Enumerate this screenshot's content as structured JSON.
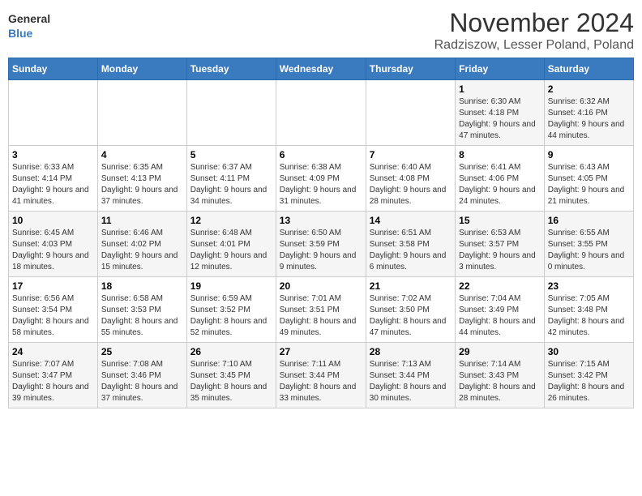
{
  "logo": {
    "text_general": "General",
    "text_blue": "Blue"
  },
  "title": "November 2024",
  "location": "Radziszow, Lesser Poland, Poland",
  "days_of_week": [
    "Sunday",
    "Monday",
    "Tuesday",
    "Wednesday",
    "Thursday",
    "Friday",
    "Saturday"
  ],
  "weeks": [
    [
      {
        "day": "",
        "info": ""
      },
      {
        "day": "",
        "info": ""
      },
      {
        "day": "",
        "info": ""
      },
      {
        "day": "",
        "info": ""
      },
      {
        "day": "",
        "info": ""
      },
      {
        "day": "1",
        "info": "Sunrise: 6:30 AM\nSunset: 4:18 PM\nDaylight: 9 hours and 47 minutes."
      },
      {
        "day": "2",
        "info": "Sunrise: 6:32 AM\nSunset: 4:16 PM\nDaylight: 9 hours and 44 minutes."
      }
    ],
    [
      {
        "day": "3",
        "info": "Sunrise: 6:33 AM\nSunset: 4:14 PM\nDaylight: 9 hours and 41 minutes."
      },
      {
        "day": "4",
        "info": "Sunrise: 6:35 AM\nSunset: 4:13 PM\nDaylight: 9 hours and 37 minutes."
      },
      {
        "day": "5",
        "info": "Sunrise: 6:37 AM\nSunset: 4:11 PM\nDaylight: 9 hours and 34 minutes."
      },
      {
        "day": "6",
        "info": "Sunrise: 6:38 AM\nSunset: 4:09 PM\nDaylight: 9 hours and 31 minutes."
      },
      {
        "day": "7",
        "info": "Sunrise: 6:40 AM\nSunset: 4:08 PM\nDaylight: 9 hours and 28 minutes."
      },
      {
        "day": "8",
        "info": "Sunrise: 6:41 AM\nSunset: 4:06 PM\nDaylight: 9 hours and 24 minutes."
      },
      {
        "day": "9",
        "info": "Sunrise: 6:43 AM\nSunset: 4:05 PM\nDaylight: 9 hours and 21 minutes."
      }
    ],
    [
      {
        "day": "10",
        "info": "Sunrise: 6:45 AM\nSunset: 4:03 PM\nDaylight: 9 hours and 18 minutes."
      },
      {
        "day": "11",
        "info": "Sunrise: 6:46 AM\nSunset: 4:02 PM\nDaylight: 9 hours and 15 minutes."
      },
      {
        "day": "12",
        "info": "Sunrise: 6:48 AM\nSunset: 4:01 PM\nDaylight: 9 hours and 12 minutes."
      },
      {
        "day": "13",
        "info": "Sunrise: 6:50 AM\nSunset: 3:59 PM\nDaylight: 9 hours and 9 minutes."
      },
      {
        "day": "14",
        "info": "Sunrise: 6:51 AM\nSunset: 3:58 PM\nDaylight: 9 hours and 6 minutes."
      },
      {
        "day": "15",
        "info": "Sunrise: 6:53 AM\nSunset: 3:57 PM\nDaylight: 9 hours and 3 minutes."
      },
      {
        "day": "16",
        "info": "Sunrise: 6:55 AM\nSunset: 3:55 PM\nDaylight: 9 hours and 0 minutes."
      }
    ],
    [
      {
        "day": "17",
        "info": "Sunrise: 6:56 AM\nSunset: 3:54 PM\nDaylight: 8 hours and 58 minutes."
      },
      {
        "day": "18",
        "info": "Sunrise: 6:58 AM\nSunset: 3:53 PM\nDaylight: 8 hours and 55 minutes."
      },
      {
        "day": "19",
        "info": "Sunrise: 6:59 AM\nSunset: 3:52 PM\nDaylight: 8 hours and 52 minutes."
      },
      {
        "day": "20",
        "info": "Sunrise: 7:01 AM\nSunset: 3:51 PM\nDaylight: 8 hours and 49 minutes."
      },
      {
        "day": "21",
        "info": "Sunrise: 7:02 AM\nSunset: 3:50 PM\nDaylight: 8 hours and 47 minutes."
      },
      {
        "day": "22",
        "info": "Sunrise: 7:04 AM\nSunset: 3:49 PM\nDaylight: 8 hours and 44 minutes."
      },
      {
        "day": "23",
        "info": "Sunrise: 7:05 AM\nSunset: 3:48 PM\nDaylight: 8 hours and 42 minutes."
      }
    ],
    [
      {
        "day": "24",
        "info": "Sunrise: 7:07 AM\nSunset: 3:47 PM\nDaylight: 8 hours and 39 minutes."
      },
      {
        "day": "25",
        "info": "Sunrise: 7:08 AM\nSunset: 3:46 PM\nDaylight: 8 hours and 37 minutes."
      },
      {
        "day": "26",
        "info": "Sunrise: 7:10 AM\nSunset: 3:45 PM\nDaylight: 8 hours and 35 minutes."
      },
      {
        "day": "27",
        "info": "Sunrise: 7:11 AM\nSunset: 3:44 PM\nDaylight: 8 hours and 33 minutes."
      },
      {
        "day": "28",
        "info": "Sunrise: 7:13 AM\nSunset: 3:44 PM\nDaylight: 8 hours and 30 minutes."
      },
      {
        "day": "29",
        "info": "Sunrise: 7:14 AM\nSunset: 3:43 PM\nDaylight: 8 hours and 28 minutes."
      },
      {
        "day": "30",
        "info": "Sunrise: 7:15 AM\nSunset: 3:42 PM\nDaylight: 8 hours and 26 minutes."
      }
    ]
  ]
}
